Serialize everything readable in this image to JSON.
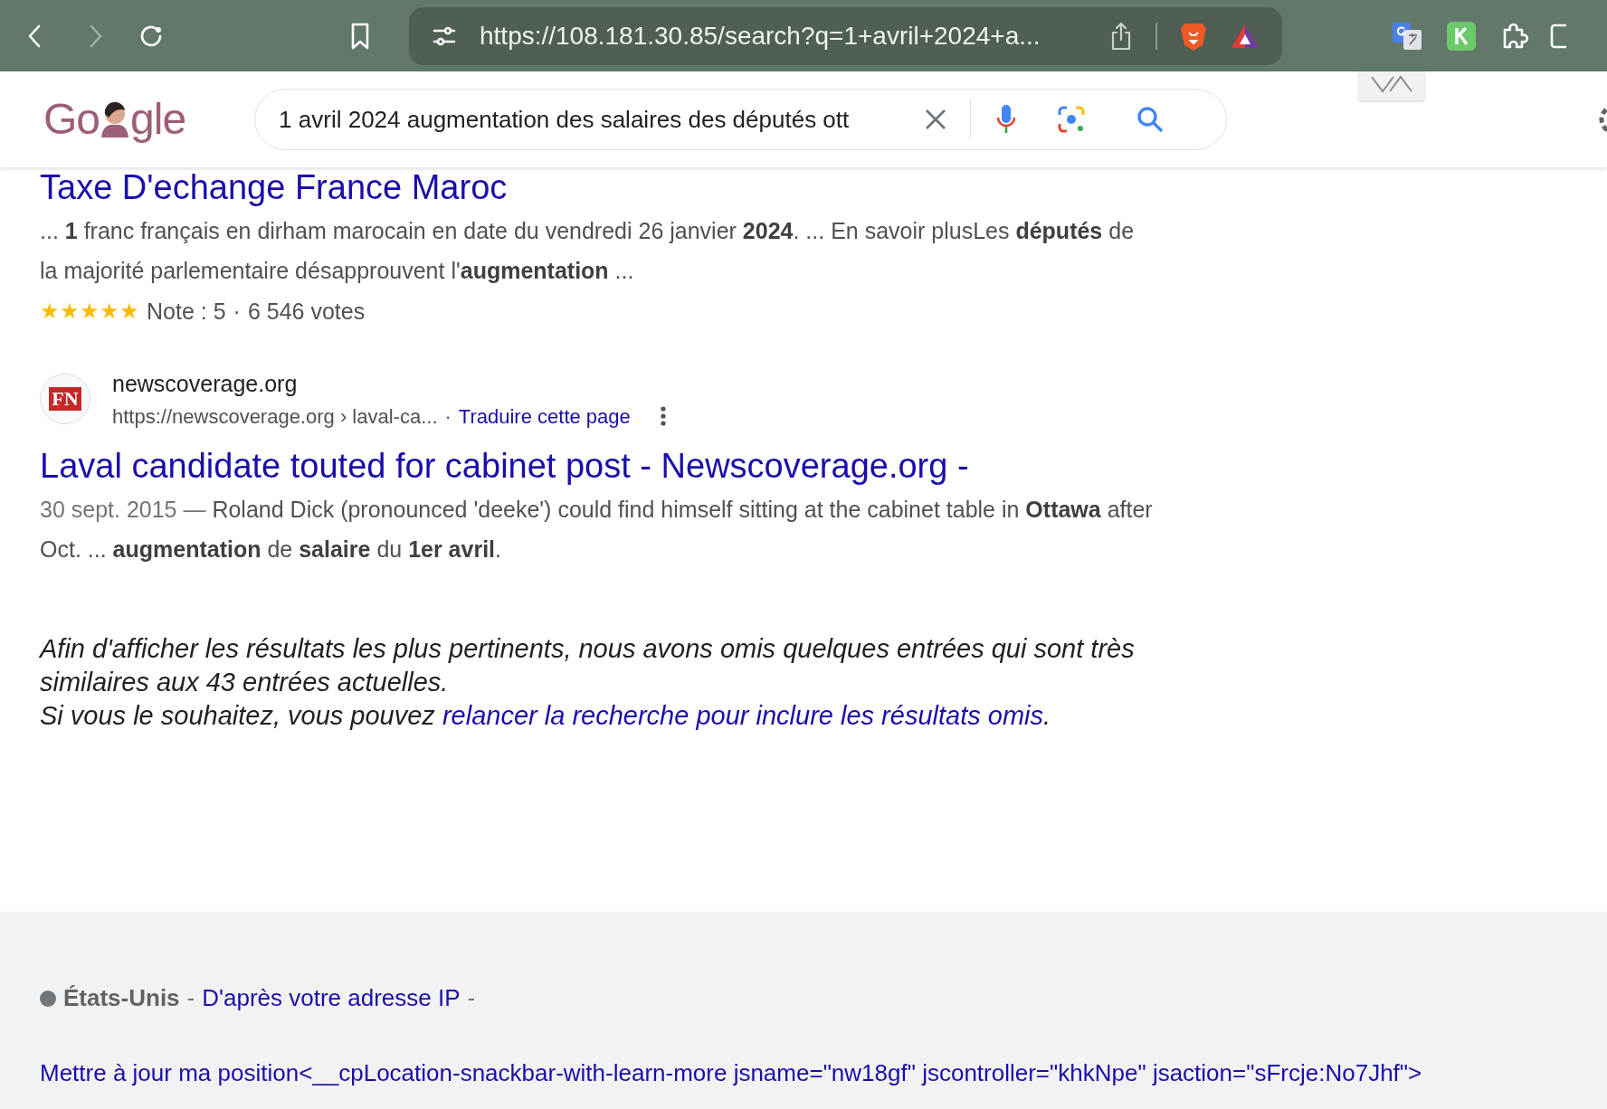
{
  "browser": {
    "url": "https://108.181.30.85/search?q=1+avril+2024+a..."
  },
  "search": {
    "logo_left": "Go",
    "logo_right": "gle",
    "query": "1 avril 2024 augmentation des salaires des députés ott"
  },
  "results": [
    {
      "kind": "partial",
      "title": "Taxe D'echange France Maroc",
      "snippet": "... **1** franc français en dirham marocain en date du vendredi 26 janvier **2024**. ... En savoir plusLes **députés** de la majorité parlementaire désapprouvent l'**augmentation** ...",
      "stars": 5,
      "rating": "Note : 5",
      "rating_separator": "·",
      "votes": "6 546 votes"
    },
    {
      "kind": "full",
      "site": "newscoverage.org",
      "favicon": "FN",
      "url": "https://newscoverage.org › laval-ca...",
      "url_separator": "·",
      "translate": "Traduire cette page",
      "title": "Laval candidate touted for cabinet post - Newscoverage.org -",
      "date": "30 sept. 2015",
      "date_separator": "—",
      "snippet": "Roland Dick (pronounced 'deeke') could find himself sitting at the cabinet table in **Ottawa** after Oct. ... **augmentation** de **salaire** du **1er avril**."
    }
  ],
  "omitted": {
    "line_1": "Afin d'afficher les résultats les plus pertinents, nous avons omis quelques entrées qui sont très similaires aux 43 entrées actuelles.",
    "line_2": "Si vous le souhaitez, vous pouvez ",
    "link": "relancer la recherche pour inclure les résultats omis",
    "end": "."
  },
  "footer": {
    "country": "États-Unis",
    "separator": "-",
    "source_link": "D'après votre adresse IP",
    "trailing": "-",
    "update_link": "Mettre à jour ma position<__cpLocation-snackbar-with-learn-more jsname=\"nw18gf\" jscontroller=\"khkNpe\" jsaction=\"sFrcje:No7Jhf\">"
  }
}
